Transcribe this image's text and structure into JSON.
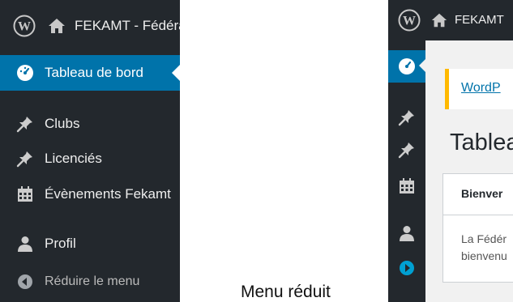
{
  "expanded_menu": {
    "site_title": "FEKAMT - Fédéra",
    "items": [
      {
        "label": "Tableau de bord",
        "icon": "dashboard-icon",
        "active": true
      },
      {
        "label": "Clubs",
        "icon": "pin-icon"
      },
      {
        "label": "Licenciés",
        "icon": "pin-icon"
      },
      {
        "label": "Évènements Fekamt",
        "icon": "calendar-icon"
      },
      {
        "label": "Profil",
        "icon": "user-icon"
      },
      {
        "label": "Réduire le menu",
        "icon": "collapse-arrow-icon"
      }
    ]
  },
  "caption": "Menu réduit",
  "collapsed_view": {
    "site_title": "FEKAMT",
    "notice_link": "WordP",
    "page_title": "Tablea",
    "welcome_title": "Bienver",
    "welcome_text_line1": "La Fédér",
    "welcome_text_line2": "bienvenu"
  },
  "colors": {
    "admin_dark": "#23282d",
    "active_blue": "#0073aa",
    "notice_yellow": "#ffb900",
    "collapse_blue": "#00a0d2"
  }
}
